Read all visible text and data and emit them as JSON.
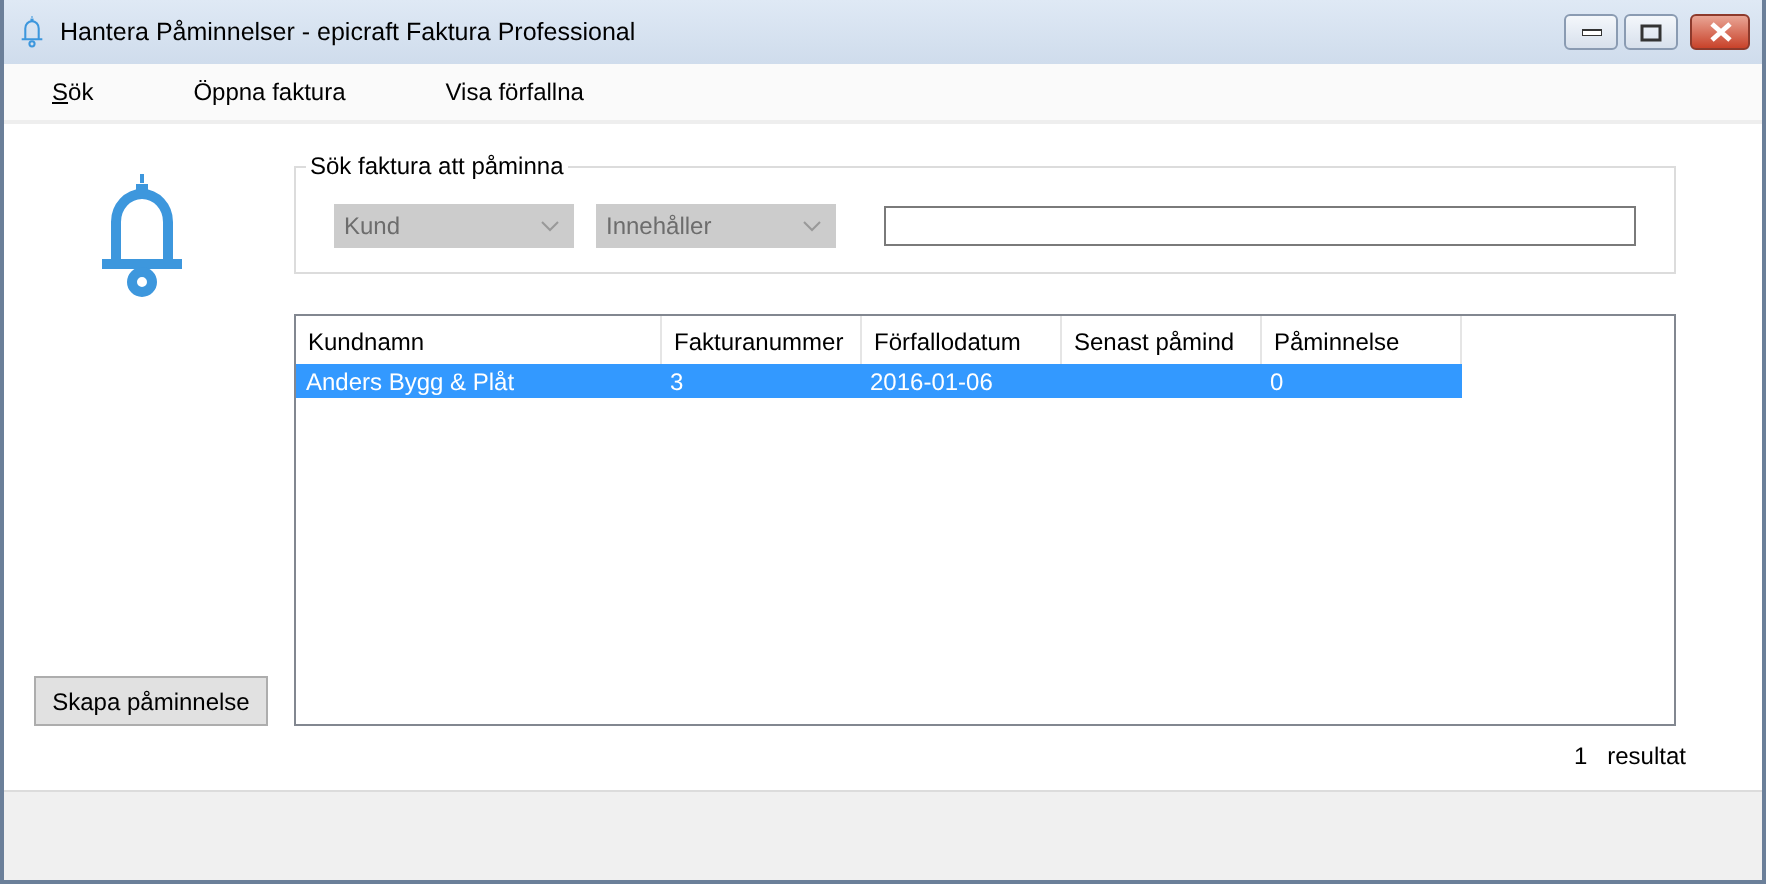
{
  "window": {
    "title": "Hantera Påminnelser - epicraft Faktura Professional"
  },
  "menu": [
    {
      "label": "Sök",
      "access_key_underlined": true
    },
    {
      "label": "Öppna faktura",
      "access_key_underlined": false
    },
    {
      "label": "Visa förfallna",
      "access_key_underlined": false
    }
  ],
  "search_group": {
    "title": "Sök faktura att påminna",
    "dropdowns": [
      {
        "value": "Kund",
        "disabled": true
      },
      {
        "value": "Innehåller",
        "disabled": true
      }
    ],
    "search_field": {
      "disabled": false
    }
  },
  "table": {
    "columns": [
      "Kundnamn",
      "Fakturanummer",
      "Förfallodatum",
      "Senast påmind",
      "Påminnelse"
    ],
    "rows": [
      {
        "cells": [
          "Anders Bygg & Plåt",
          "3",
          "2016-01-06",
          "",
          "0"
        ],
        "selected": true
      }
    ]
  },
  "create_button": "Skapa påminnelse",
  "result": {
    "count": "1",
    "label": "resultat"
  }
}
